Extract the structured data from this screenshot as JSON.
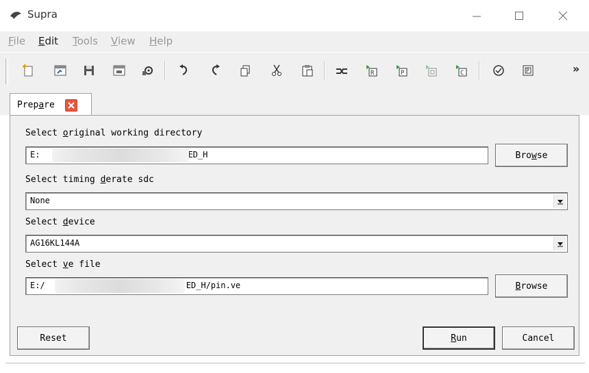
{
  "window": {
    "title": "Supra",
    "controls": [
      "minimize-icon",
      "maximize-icon",
      "close-icon"
    ]
  },
  "menu": [
    {
      "pre": "",
      "key": "F",
      "post": "ile",
      "active": false
    },
    {
      "pre": "",
      "key": "E",
      "post": "dit",
      "active": true
    },
    {
      "pre": "",
      "key": "T",
      "post": "ools",
      "active": false
    },
    {
      "pre": "",
      "key": "V",
      "post": "iew",
      "active": false
    },
    {
      "pre": "",
      "key": "H",
      "post": "elp",
      "active": false
    }
  ],
  "toolbar": {
    "icons": [
      "new-file-icon",
      "open-project-icon",
      "save-icon",
      "save-as-icon",
      "settings-icon",
      "undo-icon",
      "redo-icon",
      "copy-icon",
      "cut-icon",
      "paste-icon",
      "prepare-flow-icon",
      "run-r-icon",
      "run-p-icon",
      "run-d-icon",
      "run-c-icon",
      "check-icon",
      "report-icon"
    ],
    "more": "»"
  },
  "tab": {
    "label_pre": "Prep",
    "label_key": "a",
    "label_post": "re"
  },
  "form": {
    "working_dir": {
      "label_pre": "Select ",
      "label_key": "o",
      "label_post": "riginal working directory",
      "value_prefix": "E:",
      "value_suffix": "ED_H",
      "browse_pre": "Bro",
      "browse_key": "w",
      "browse_post": "se"
    },
    "derate": {
      "label_pre": "Select timing ",
      "label_key": "d",
      "label_post": "erate sdc",
      "value": "None"
    },
    "device": {
      "label_pre": "Select ",
      "label_key": "d",
      "label_post": "evice",
      "value": "AG16KL144A"
    },
    "ve_file": {
      "label_pre": "Select ",
      "label_key": "v",
      "label_post": "e file",
      "value_prefix": "E:/",
      "value_suffix": "ED_H/pin.ve",
      "browse_pre": "",
      "browse_key": "B",
      "browse_post": "rowse"
    }
  },
  "buttons": {
    "reset": "Reset",
    "run_key": "R",
    "run_post": "un",
    "cancel": "Cancel"
  },
  "colors": {
    "tab_close": "#e8553f",
    "toolbar_green": "#2e9e3e"
  }
}
